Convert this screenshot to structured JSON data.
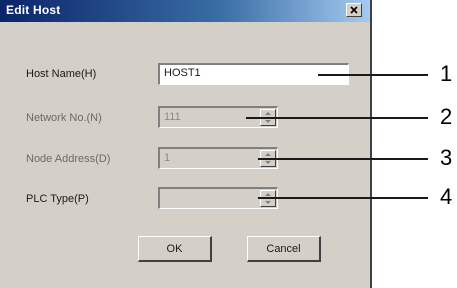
{
  "dialog": {
    "title": "Edit Host",
    "fields": [
      {
        "label": "Host Name(H)",
        "value": "HOST1"
      },
      {
        "label": "Network No.(N)",
        "value": "111"
      },
      {
        "label": "Node Address(D)",
        "value": "1"
      },
      {
        "label": "PLC Type(P)",
        "value": ""
      }
    ],
    "buttons": {
      "ok": "OK",
      "cancel": "Cancel"
    }
  },
  "callouts": [
    "1",
    "2",
    "3",
    "4"
  ]
}
